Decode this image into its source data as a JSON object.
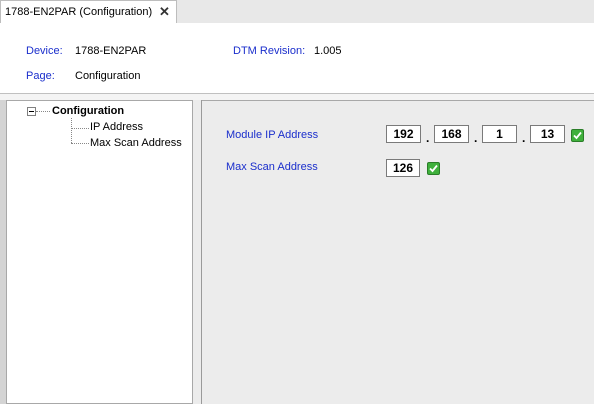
{
  "tab": {
    "title": "1788-EN2PAR  (Configuration)",
    "close_glyph": "✕"
  },
  "header": {
    "device_label": "Device:",
    "device_value": "1788-EN2PAR",
    "dtm_label": "DTM Revision:",
    "dtm_value": "1.005",
    "page_label": "Page:",
    "page_value": "Configuration"
  },
  "tree": {
    "root": "Configuration",
    "children": [
      "IP Address",
      "Max Scan Address"
    ]
  },
  "form": {
    "ip_label": "Module IP Address",
    "ip_octets": [
      "192",
      "168",
      "1",
      "13"
    ],
    "ip_separator": ".",
    "max_scan_label": "Max Scan Address",
    "max_scan_value": "126"
  },
  "colors": {
    "label_blue": "#1a2ecc",
    "ok_green": "#3fb03c"
  },
  "icons": {
    "collapse": "minus-box-icon",
    "valid": "green-check-icon",
    "close": "close-icon"
  }
}
